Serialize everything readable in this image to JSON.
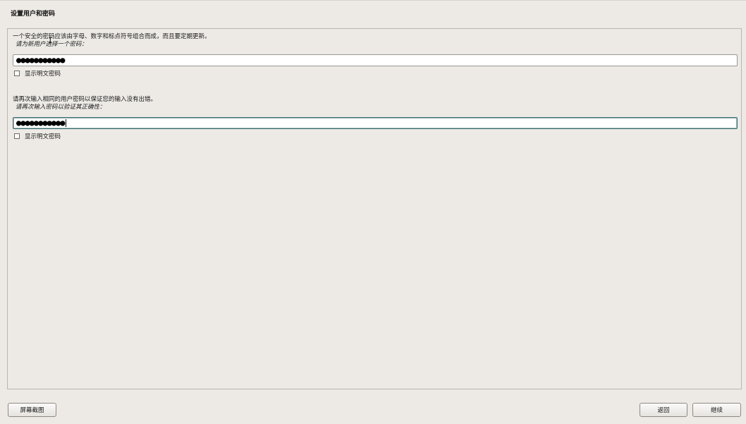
{
  "header": {
    "title": "设置用户和密码"
  },
  "password_section": {
    "explanation": "一个安全的密码应该由字母、数字和标点符号组合而成，而且要定期更新。",
    "prompt": "请为新用户选择一个密码：",
    "value_masked": "●●●●●●●●●●●",
    "show_password_label": "显示明文密码",
    "show_password_checked": false
  },
  "confirm_section": {
    "explanation": "请再次输入相同的用户密码以保证您的输入没有出错。",
    "prompt": "请再次输入密码以验证其正确性：",
    "value_masked": "●●●●●●●●●●●",
    "show_password_label": "显示明文密码",
    "show_password_checked": false
  },
  "footer": {
    "screenshot_label": "屏幕截图",
    "back_label": "返回",
    "continue_label": "继续"
  },
  "colors": {
    "background": "#edeae6",
    "focus_border": "#3f6e6e"
  }
}
